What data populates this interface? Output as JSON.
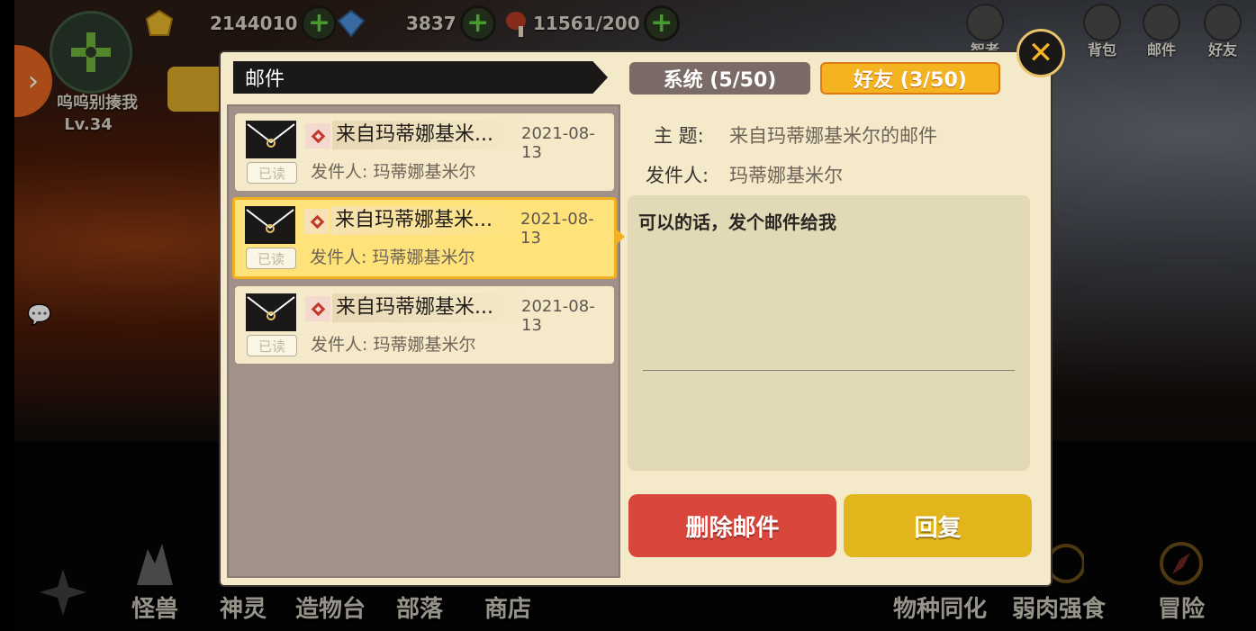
{
  "player": {
    "name": "呜呜别揍我",
    "level": "Lv.34"
  },
  "resources": [
    {
      "icon": "gold-icon",
      "value": "2144010"
    },
    {
      "icon": "gem-icon",
      "value": "3837"
    },
    {
      "icon": "meat-icon",
      "value": "11561/200"
    }
  ],
  "top_nav": [
    {
      "icon": "sage-icon",
      "label": "智者"
    },
    {
      "icon": "backpack-icon",
      "label": "背包"
    },
    {
      "icon": "mail-icon",
      "label": "邮件"
    },
    {
      "icon": "friends-icon",
      "label": "好友"
    }
  ],
  "bottom_nav": [
    {
      "icon": "monster-icon",
      "label": "怪兽"
    },
    {
      "icon": "spirit-icon",
      "label": "神灵"
    },
    {
      "icon": "workbench-icon",
      "label": "造物台"
    },
    {
      "icon": "tribe-icon",
      "label": "部落"
    },
    {
      "icon": "shop-icon",
      "label": "商店"
    },
    {
      "icon": "assimilation-icon",
      "label": "物种同化"
    },
    {
      "icon": "predation-icon",
      "label": "弱肉强食"
    },
    {
      "icon": "adventure-icon",
      "label": "冒险"
    }
  ],
  "mail": {
    "title": "邮件",
    "tabs": [
      {
        "label": "系统 (5/50)",
        "active": false
      },
      {
        "label": "好友 (3/50)",
        "active": true
      }
    ],
    "items": [
      {
        "subject": "来自玛蒂娜基米...",
        "date": "2021-08-13",
        "read_tag": "已读",
        "sender": "发件人:  玛蒂娜基米尔"
      },
      {
        "subject": "来自玛蒂娜基米...",
        "date": "2021-08-13",
        "read_tag": "已读",
        "sender": "发件人:  玛蒂娜基米尔"
      },
      {
        "subject": "来自玛蒂娜基米...",
        "date": "2021-08-13",
        "read_tag": "已读",
        "sender": "发件人:  玛蒂娜基米尔"
      }
    ],
    "detail": {
      "subject_label": "主  题:",
      "subject_value": "来自玛蒂娜基米尔的邮件",
      "sender_label": "发件人:",
      "sender_value": "玛蒂娜基米尔",
      "body": "可以的话，发个邮件给我"
    },
    "buttons": {
      "delete": "删除邮件",
      "reply": "回复"
    }
  },
  "colors": {
    "accent": "#f4b321",
    "delete": "#d9473c",
    "reply": "#e3b51d",
    "panel": "#f4e9c8"
  }
}
